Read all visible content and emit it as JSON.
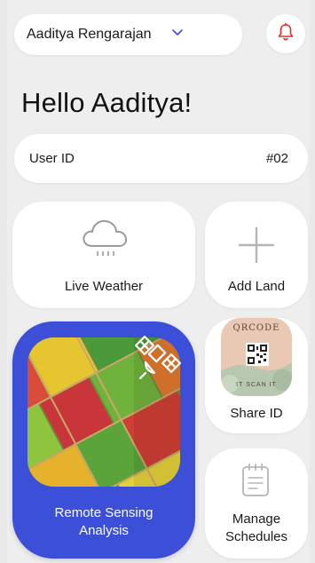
{
  "header": {
    "user_name": "Aaditya Rengarajan",
    "dropdown_icon": "chevron-down-icon",
    "bell_icon": "bell-icon"
  },
  "greeting": "Hello Aaditya!",
  "user_id": {
    "label": "User ID",
    "value": "#02"
  },
  "tiles": {
    "live_weather": {
      "label": "Live Weather",
      "icon": "cloud-rain-icon"
    },
    "add_land": {
      "label": "Add Land",
      "icon": "plus-icon"
    },
    "remote_sensing": {
      "line1": "Remote Sensing",
      "line2": "Analysis",
      "icon": "satellite-icon"
    },
    "share_id": {
      "label": "Share ID",
      "icon": "qr-code-icon",
      "qr_caption_top": "QRCODE",
      "qr_caption_bottom": "IT SCAN IT"
    },
    "manage_schedules": {
      "line1": "Manage",
      "line2": "Schedules",
      "icon": "notepad-icon"
    }
  },
  "colors": {
    "accent": "#3b4fd9",
    "background": "#eeeeee",
    "card": "#ffffff",
    "chevron": "#3b4fd9",
    "bell": "#e0312b"
  }
}
